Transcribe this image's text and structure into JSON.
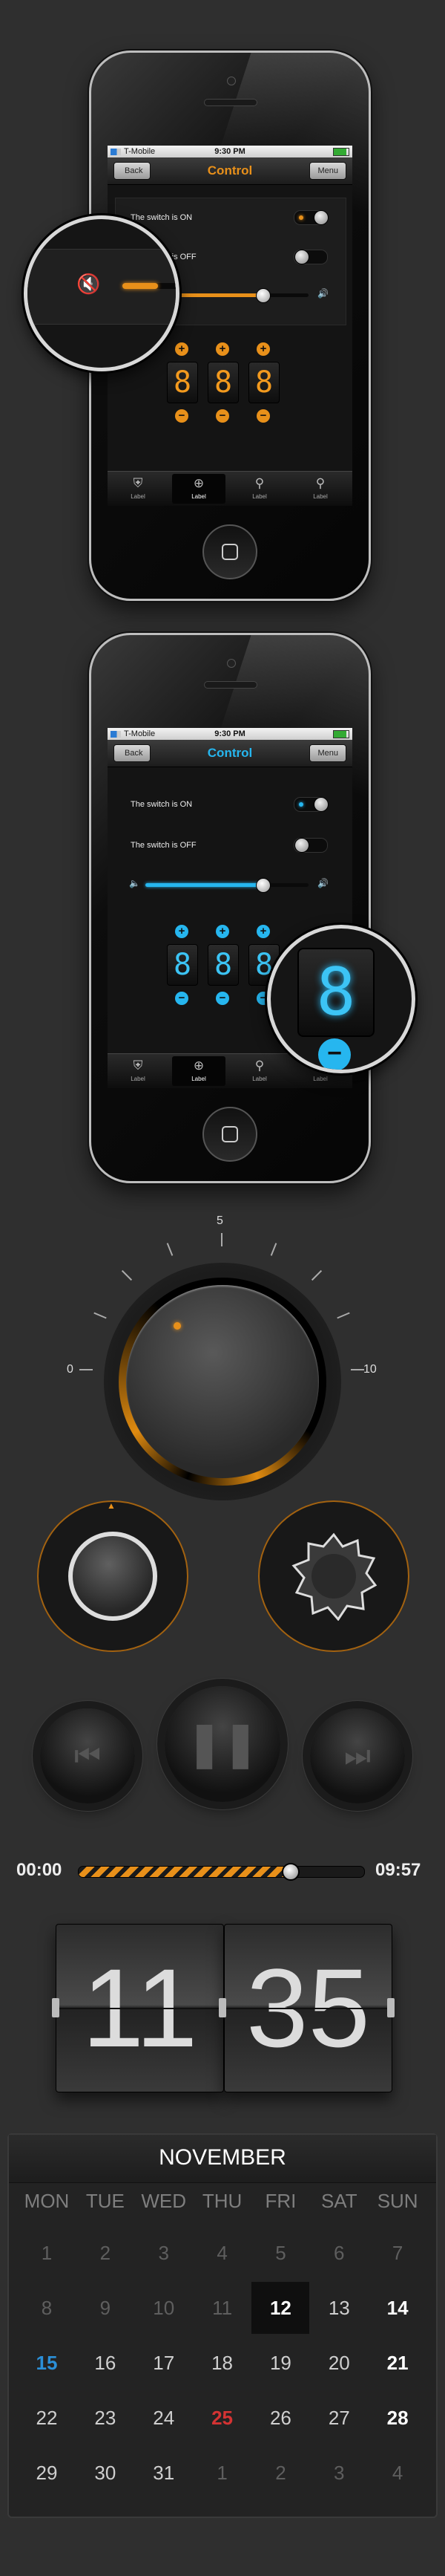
{
  "colors": {
    "orange": "#e8901a",
    "blue": "#26b6ef",
    "background": "#2f2f2f"
  },
  "phone_orange": {
    "status": {
      "carrier": "T-Mobile",
      "time": "9:30 PM"
    },
    "nav": {
      "back_label": "Back",
      "title": "Control",
      "menu_label": "Menu"
    },
    "switch_on_label": "The switch is ON",
    "switch_off_label": "The switch is OFF",
    "volume_level": 0.72,
    "digits": [
      "8",
      "8",
      "8"
    ],
    "plus": "+",
    "minus": "−",
    "tabs": [
      {
        "icon": "shield-icon",
        "label": "Label"
      },
      {
        "icon": "target-icon",
        "label": "Label"
      },
      {
        "icon": "joystick-icon",
        "label": "Label"
      },
      {
        "icon": "pin-icon",
        "label": "Label"
      }
    ],
    "active_tab": 1,
    "magnifier": {
      "icon": "mute-icon",
      "slider_level": 0.6
    }
  },
  "phone_blue": {
    "status": {
      "carrier": "T-Mobile",
      "time": "9:30 PM"
    },
    "nav": {
      "back_label": "Back",
      "title": "Control",
      "menu_label": "Menu"
    },
    "switch_on_label": "The switch is ON",
    "switch_off_label": "The switch is OFF",
    "volume_level": 0.72,
    "digits": [
      "8",
      "8",
      "8"
    ],
    "plus": "+",
    "minus": "−",
    "tabs": [
      {
        "icon": "shield-icon",
        "label": "Label"
      },
      {
        "icon": "target-icon",
        "label": "Label"
      },
      {
        "icon": "joystick-icon",
        "label": "Label"
      },
      {
        "icon": "pin-icon",
        "label": "Label"
      }
    ],
    "active_tab": 1,
    "magnifier": {
      "digit": "8",
      "minus": "−"
    }
  },
  "big_knob": {
    "scale_min": "0",
    "scale_mid": "5",
    "scale_max": "10"
  },
  "media": {
    "prev_icon": "skip-back-icon",
    "pause_icon": "pause-icon",
    "next_icon": "skip-forward-icon"
  },
  "progress": {
    "elapsed": "00:00",
    "total": "09:57",
    "fraction": 0.74
  },
  "flip_clock": {
    "hours": "11",
    "minutes": "35"
  },
  "calendar": {
    "month": "NOVEMBER",
    "weekdays": [
      "MON",
      "TUE",
      "WED",
      "THU",
      "FRI",
      "SAT",
      "SUN"
    ],
    "weeks": [
      [
        "1",
        "2",
        "3",
        "4",
        "5",
        "6",
        "7"
      ],
      [
        "8",
        "9",
        "10",
        "11",
        "12",
        "13",
        "14"
      ],
      [
        "15",
        "16",
        "17",
        "18",
        "19",
        "20",
        "21"
      ],
      [
        "22",
        "23",
        "24",
        "25",
        "26",
        "27",
        "28"
      ],
      [
        "29",
        "30",
        "31",
        "1",
        "2",
        "3",
        "4"
      ]
    ],
    "styles": [
      [
        "other",
        "other",
        "other",
        "other",
        "other",
        "other",
        "other"
      ],
      [
        "other",
        "other",
        "other",
        "other",
        "today",
        "norm",
        "weekend"
      ],
      [
        "blue",
        "norm",
        "norm",
        "norm",
        "norm",
        "norm",
        "weekend"
      ],
      [
        "norm",
        "norm",
        "norm",
        "red",
        "norm",
        "norm",
        "weekend"
      ],
      [
        "norm",
        "norm",
        "norm",
        "other",
        "other",
        "other",
        "other"
      ]
    ]
  }
}
